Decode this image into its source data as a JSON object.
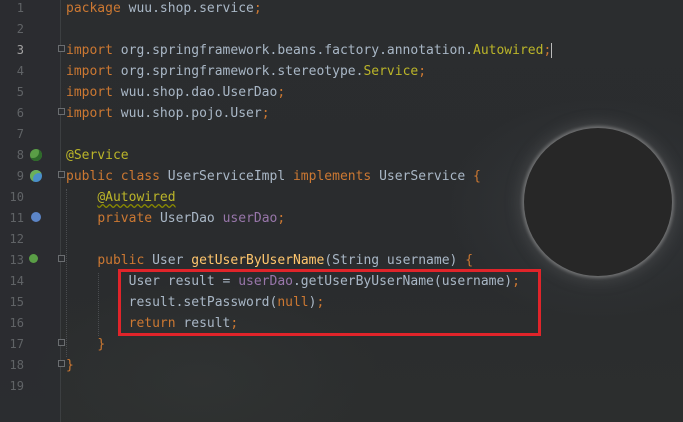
{
  "editor": {
    "lines": [
      {
        "n": "1",
        "parts": [
          [
            "kw",
            "package "
          ],
          [
            "pkg",
            "wuu.shop.service"
          ],
          [
            "kw",
            ";"
          ]
        ]
      },
      {
        "n": "2",
        "parts": []
      },
      {
        "n": "3",
        "parts": [
          [
            "kw",
            "import "
          ],
          [
            "pkg",
            "org.springframework.beans.factory.annotation."
          ],
          [
            "ann",
            "Autowired"
          ],
          [
            "kw",
            ";"
          ]
        ]
      },
      {
        "n": "4",
        "parts": [
          [
            "kw",
            "import "
          ],
          [
            "pkg",
            "org.springframework.stereotype."
          ],
          [
            "ann",
            "Service"
          ],
          [
            "kw",
            ";"
          ]
        ]
      },
      {
        "n": "5",
        "parts": [
          [
            "kw",
            "import "
          ],
          [
            "pkg",
            "wuu.shop.dao.UserDao"
          ],
          [
            "kw",
            ";"
          ]
        ]
      },
      {
        "n": "6",
        "parts": [
          [
            "kw",
            "import "
          ],
          [
            "pkg",
            "wuu.shop.pojo.User"
          ],
          [
            "kw",
            ";"
          ]
        ]
      },
      {
        "n": "7",
        "parts": []
      },
      {
        "n": "8",
        "parts": [
          [
            "ann",
            "@Service"
          ]
        ]
      },
      {
        "n": "9",
        "parts": [
          [
            "kw",
            "public class "
          ],
          [
            "type",
            "UserServiceImpl "
          ],
          [
            "kw",
            "implements "
          ],
          [
            "type",
            "UserService "
          ],
          [
            "kw",
            "{"
          ]
        ]
      },
      {
        "n": "10",
        "parts": [
          [
            "type",
            "    "
          ],
          [
            "ann-u",
            "@Autowired"
          ]
        ]
      },
      {
        "n": "11",
        "parts": [
          [
            "type",
            "    "
          ],
          [
            "kw",
            "private "
          ],
          [
            "type",
            "UserDao "
          ],
          [
            "field",
            "userDao"
          ],
          [
            "kw",
            ";"
          ]
        ]
      },
      {
        "n": "12",
        "parts": []
      },
      {
        "n": "13",
        "parts": [
          [
            "type",
            "    "
          ],
          [
            "kw",
            "public "
          ],
          [
            "type",
            "User "
          ],
          [
            "fn",
            "getUserByUserName"
          ],
          [
            "type",
            "(String username) "
          ],
          [
            "kw",
            "{"
          ]
        ]
      },
      {
        "n": "14",
        "parts": [
          [
            "type",
            "        User result = "
          ],
          [
            "field",
            "userDao"
          ],
          [
            "type",
            ".getUserByUserName(username)"
          ],
          [
            "kw",
            ";"
          ]
        ]
      },
      {
        "n": "15",
        "parts": [
          [
            "type",
            "        result.setPassword("
          ],
          [
            "kw",
            "null"
          ],
          [
            "type",
            ")"
          ],
          [
            "kw",
            ";"
          ]
        ]
      },
      {
        "n": "16",
        "parts": [
          [
            "type",
            "        "
          ],
          [
            "kw",
            "return "
          ],
          [
            "type",
            "result"
          ],
          [
            "kw",
            ";"
          ]
        ]
      },
      {
        "n": "17",
        "parts": [
          [
            "type",
            "    "
          ],
          [
            "kw",
            "}"
          ]
        ]
      },
      {
        "n": "18",
        "parts": [
          [
            "kw",
            "}"
          ]
        ]
      },
      {
        "n": "19",
        "parts": []
      }
    ],
    "current_line": "3",
    "colors": {
      "keyword": "#cc7832",
      "annotation": "#bbb529",
      "method": "#ffc66d",
      "field": "#9876aa",
      "text": "#a9b7c6",
      "highlight": "#e0242a"
    }
  }
}
